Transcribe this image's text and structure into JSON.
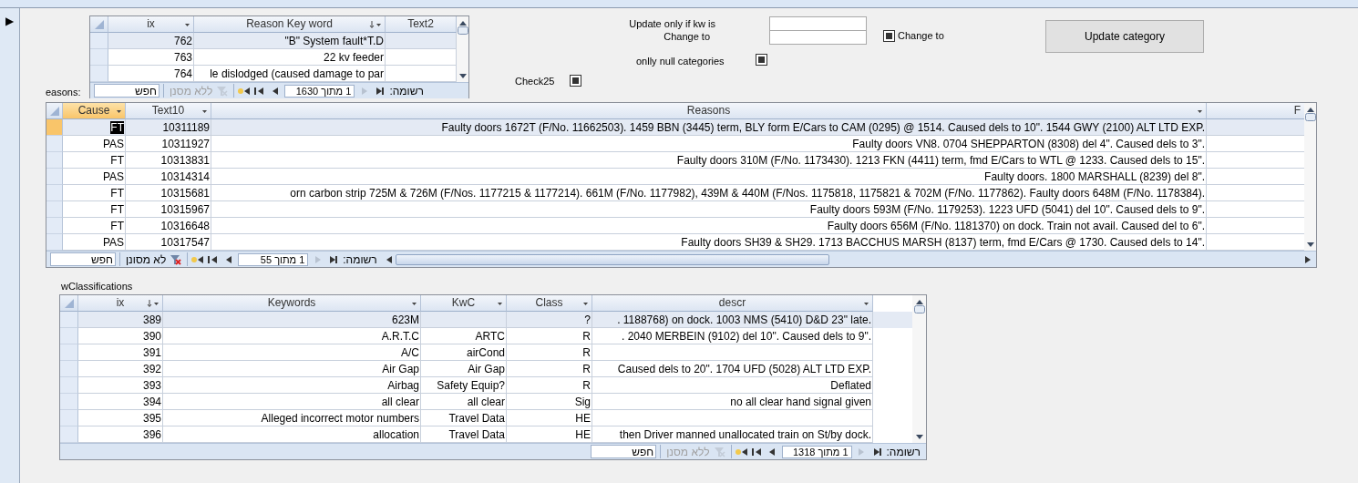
{
  "record_selector": {
    "marker": "▶"
  },
  "keywords_subform": {
    "columns": [
      {
        "label": "ix",
        "has_menu": true,
        "sorted": false,
        "selected": false
      },
      {
        "label": "Reason Key word",
        "has_menu": true,
        "sorted": true,
        "selected": false
      },
      {
        "label": "Text2",
        "has_menu": false,
        "sorted": false,
        "selected": false
      }
    ],
    "rows": [
      {
        "cells": [
          "762",
          "\"B\" System fault*T.D",
          null
        ],
        "selected": true,
        "editing": false
      },
      {
        "cells": [
          "763",
          "22 kv feeder",
          null
        ],
        "selected": false,
        "editing": false
      },
      {
        "cells": [
          "764",
          "le dislodged (caused damage to par",
          null
        ],
        "selected": false,
        "editing": false
      }
    ],
    "nav": {
      "label": "רשומה:",
      "counter": "1 מתוך 1630",
      "filter": "ללא מסנן",
      "filter_active": false,
      "search": {
        "placeholder": "חפש"
      }
    }
  },
  "update_form": {
    "kw_label": "Update only if kw is",
    "change_label": "Change to",
    "change_checkbox": {
      "label": "Change to",
      "checked": true
    },
    "null_categories": {
      "label": "onlly null categories",
      "checked": true
    },
    "check25": {
      "label": "Check25",
      "checked": true
    },
    "update_button": "Update category"
  },
  "reasons_label": "easons:",
  "reasons": {
    "columns": [
      {
        "label": "Cause",
        "has_menu": true,
        "sorted": false,
        "selected": true
      },
      {
        "label": "Text10",
        "has_menu": true,
        "sorted": false,
        "selected": false
      },
      {
        "label": "Reasons",
        "has_menu": true,
        "sorted": false,
        "selected": false
      },
      {
        "label": "F",
        "selected": false
      }
    ],
    "rows": [
      {
        "cells": [
          "FT",
          "10311189",
          "Faulty doors 1672T (F/No. 11662503). 1459 BBN (3445) term, BLY form E/Cars to CAM (0295) @ 1514. Caused dels to 10\". 1544 GWY (2100) ALT LTD EXP.",
          null
        ],
        "selected": true,
        "editing": true
      },
      {
        "cells": [
          "PAS",
          "10311927",
          "Faulty doors VN8. 0704 SHEPPARTON (8308) del 4\". Caused dels to 3\".",
          null
        ],
        "selected": false,
        "editing": false
      },
      {
        "cells": [
          "FT",
          "10313831",
          "Faulty doors 310M (F/No. 1173430). 1213 FKN (4411) term, fmd E/Cars to WTL @ 1233. Caused dels to 15\".",
          null
        ],
        "selected": false,
        "editing": false
      },
      {
        "cells": [
          "PAS",
          "10314314",
          "Faulty doors. 1800 MARSHALL (8239) del 8\".",
          null
        ],
        "selected": false,
        "editing": false
      },
      {
        "cells": [
          "FT",
          "10315681",
          "orn carbon strip 725M & 726M (F/Nos. 1177215 & 1177214). 661M (F/No. 1177982), 439M & 440M (F/Nos. 1175818, 1175821 & 702M (F/No. 1177862). Faulty doors 648M (F/No. 1178384).",
          null
        ],
        "selected": false,
        "editing": false
      },
      {
        "cells": [
          "FT",
          "10315967",
          "Faulty doors 593M (F/No. 1179253). 1223 UFD (5041) del 10\". Caused dels to 9\".",
          null
        ],
        "selected": false,
        "editing": false
      },
      {
        "cells": [
          "FT",
          "10316648",
          "Faulty doors 656M (F/No. 1181370) on dock. Train not avail. Caused del to 6\".",
          null
        ],
        "selected": false,
        "editing": false
      },
      {
        "cells": [
          "PAS",
          "10317547",
          "Faulty doors SH39 & SH29. 1713 BACCHUS MARSH (8137) term, fmd E/Cars @ 1730. Caused dels to 14\".",
          null
        ],
        "selected": false,
        "editing": false
      }
    ],
    "nav": {
      "label": "רשומה:",
      "counter": "1 מתוך 55",
      "filter": "לא מסונן",
      "filter_active": true,
      "search": {
        "placeholder": "חפש"
      }
    }
  },
  "kw_label": "wClassifications",
  "kw_classifications": {
    "columns": [
      {
        "label": "ix",
        "has_menu": true,
        "sorted": true,
        "selected": false
      },
      {
        "label": "Keywords",
        "has_menu": true,
        "sorted": false,
        "selected": false
      },
      {
        "label": "KwC",
        "has_menu": true,
        "sorted": false,
        "selected": false
      },
      {
        "label": "Class",
        "has_menu": true,
        "sorted": false,
        "selected": false
      },
      {
        "label": "descr",
        "has_menu": true,
        "sorted": false,
        "selected": false
      }
    ],
    "rows": [
      {
        "cells": [
          "389",
          "623M",
          null,
          "?",
          ". 1188768) on dock. 1003 NMS (5410) D&D 23\" late."
        ],
        "selected": true,
        "editing": false
      },
      {
        "cells": [
          "390",
          "A.R.T.C",
          "ARTC",
          "R",
          ". 2040 MERBEIN (9102) del 10\". Caused dels to 9\"."
        ],
        "selected": false,
        "editing": false
      },
      {
        "cells": [
          "391",
          "A/C",
          "airCond",
          "R",
          null
        ],
        "selected": false,
        "editing": false
      },
      {
        "cells": [
          "392",
          "Air Gap",
          "Air Gap",
          "R",
          "Caused dels to 20\". 1704 UFD (5028) ALT LTD EXP."
        ],
        "selected": false,
        "editing": false
      },
      {
        "cells": [
          "393",
          "Airbag",
          "Safety Equip?",
          "R",
          "Deflated"
        ],
        "selected": false,
        "editing": false
      },
      {
        "cells": [
          "394",
          "all clear",
          "all clear",
          "Sig",
          "no all clear hand signal given"
        ],
        "selected": false,
        "editing": false
      },
      {
        "cells": [
          "395",
          "Alleged incorrect motor numbers",
          "Travel Data",
          "HE",
          null
        ],
        "selected": false,
        "editing": false
      },
      {
        "cells": [
          "396",
          "allocation",
          "Travel Data",
          "HE",
          "then Driver manned unallocated train on St/by dock."
        ],
        "selected": false,
        "editing": false
      }
    ],
    "nav": {
      "label": "רשומה:",
      "counter": "1 מתוך 1318",
      "filter": "ללא מסנן",
      "filter_active": false,
      "search": {
        "placeholder": "חפש"
      }
    }
  }
}
